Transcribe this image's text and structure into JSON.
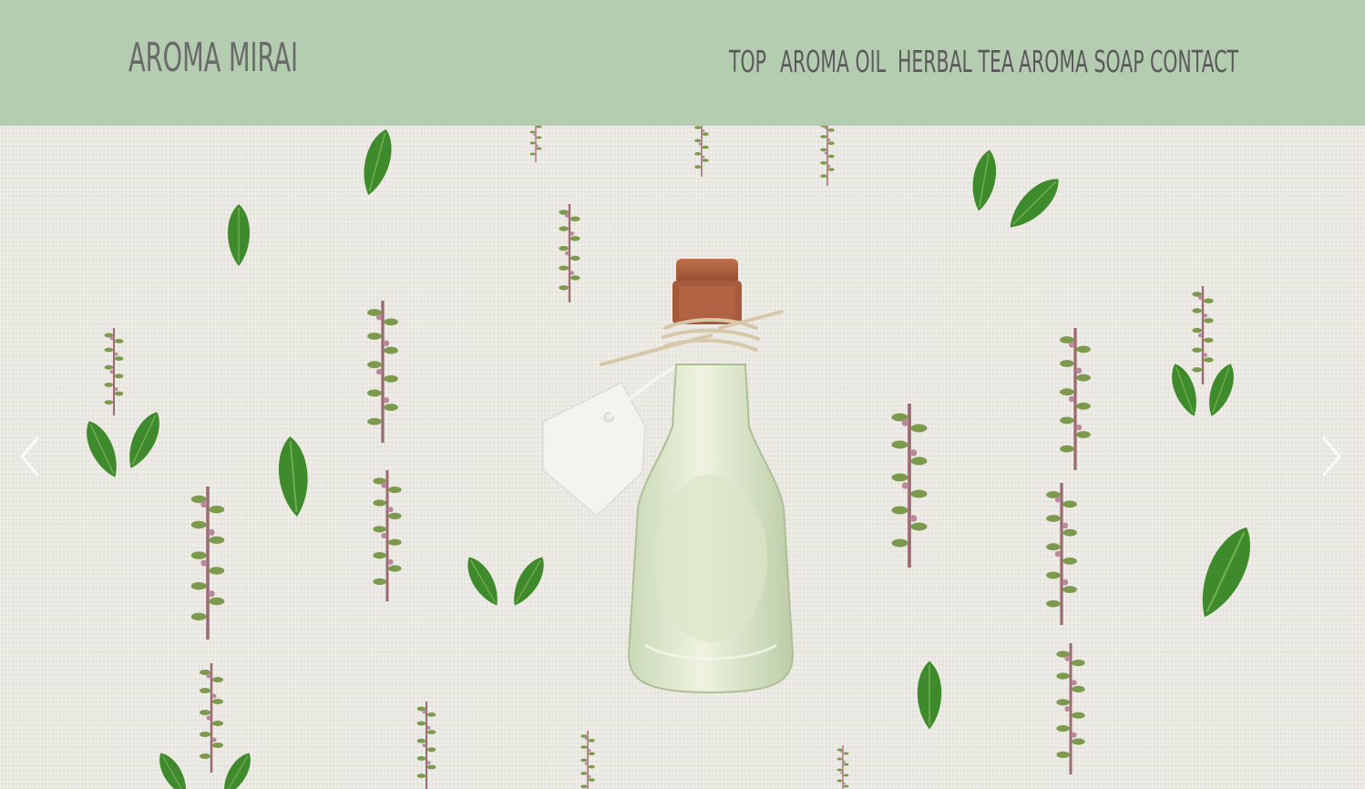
{
  "header": {
    "logo": "AROMA MIRAI",
    "background_color": "#b4cdb0",
    "nav": [
      {
        "label": "TOP"
      },
      {
        "label": "AROMA OIL"
      },
      {
        "label": "HERBAL TEA"
      },
      {
        "label": "AROMA SOAP"
      },
      {
        "label": "CONTACT"
      }
    ]
  },
  "hero": {
    "image": "photo-aroma-oil-bottle-with-basil-leaves",
    "prev_icon": "chevron-left-icon",
    "next_icon": "chevron-right-icon"
  }
}
